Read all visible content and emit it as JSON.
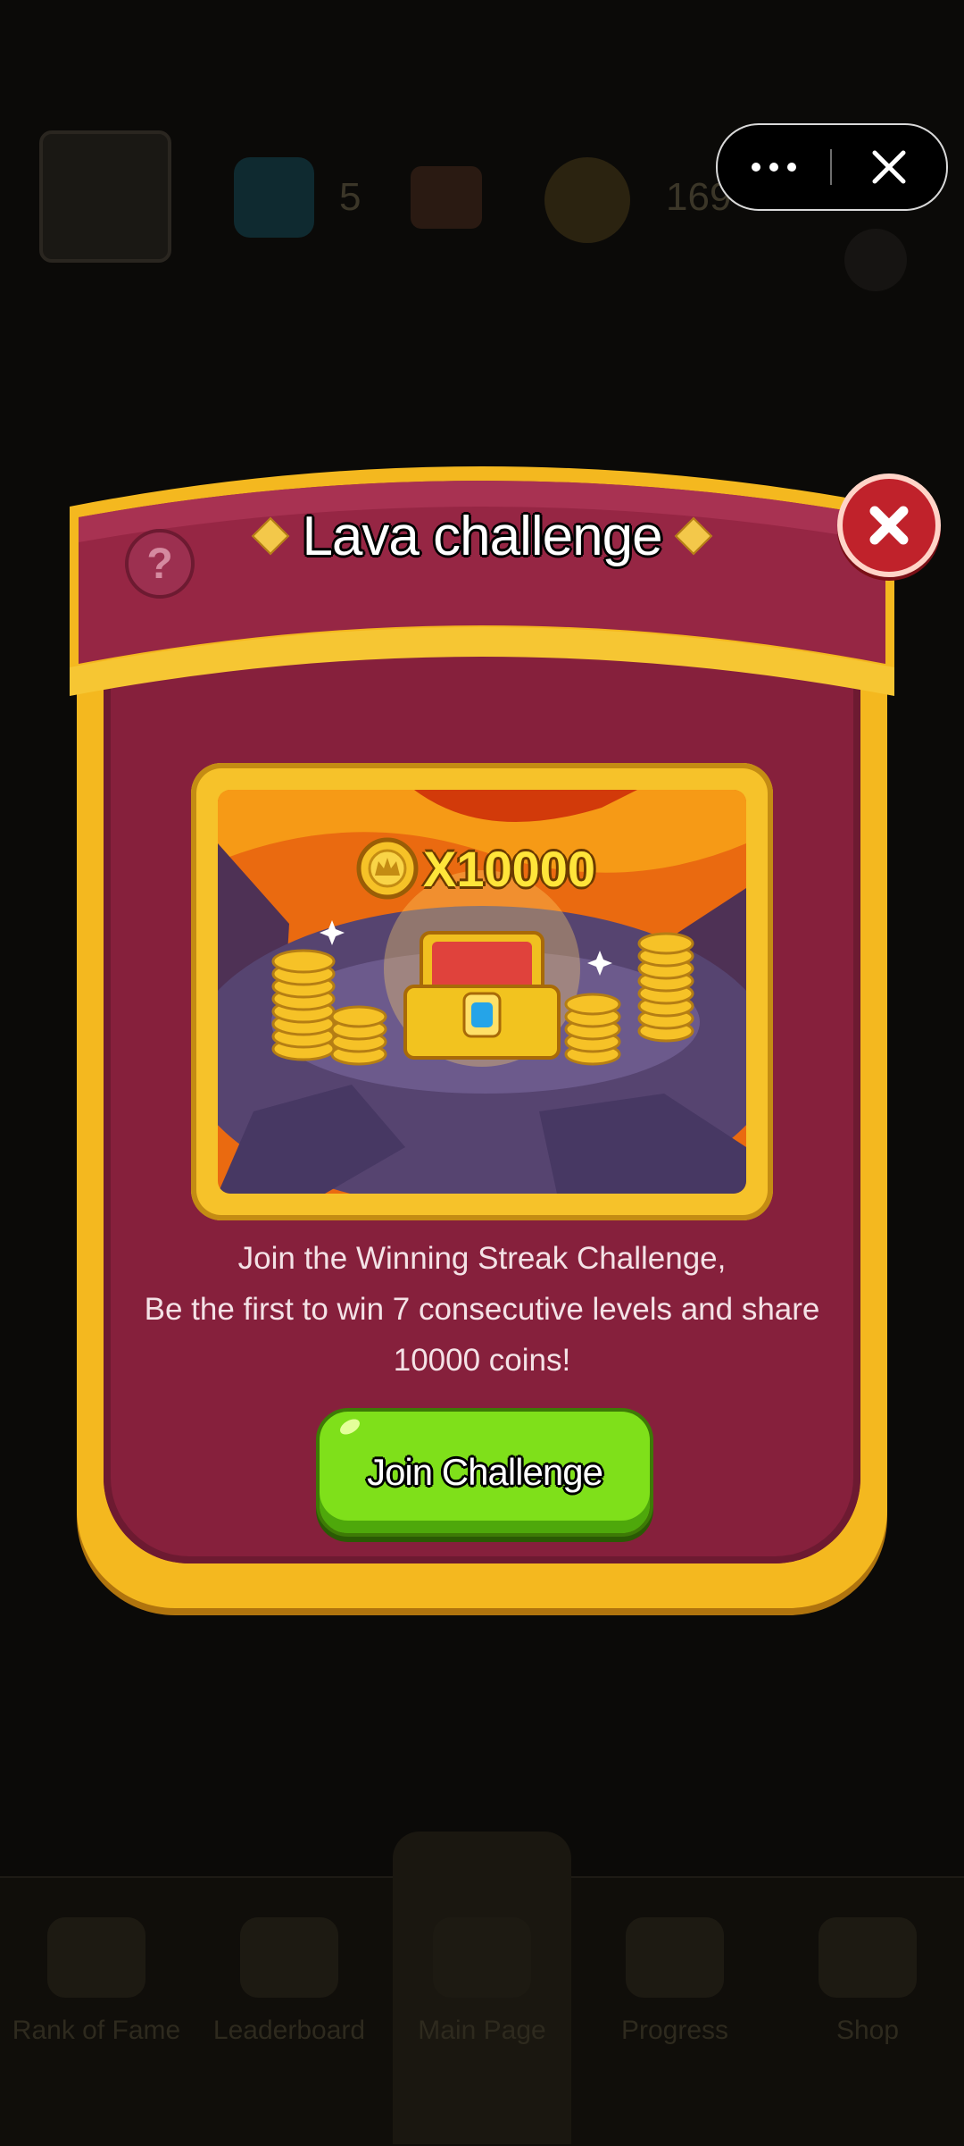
{
  "background": {
    "gem_count": "5",
    "coin_count": "169",
    "nav_items": [
      "Rank of Fame",
      "Leaderboard",
      "Main Page",
      "Progress",
      "Shop"
    ]
  },
  "capsule": {
    "more_icon": "more-dots-icon",
    "close_icon": "close-x-icon"
  },
  "dialog": {
    "title": "Lava challenge",
    "help_icon": "question-icon",
    "help_label": "?",
    "close_icon": "close-icon",
    "reward": {
      "label": "X10000",
      "icon": "gold-coin-icon"
    },
    "description_lines": [
      "Join the Winning Streak Challenge,",
      "Be the first to win 7 consecutive levels and share",
      "10000 coins!"
    ],
    "join_button": "Join Challenge"
  },
  "colors": {
    "panel_gold": "#f4b81f",
    "panel_maroon": "#86203c",
    "button_green": "#7fe01a",
    "close_red": "#c0222b"
  }
}
